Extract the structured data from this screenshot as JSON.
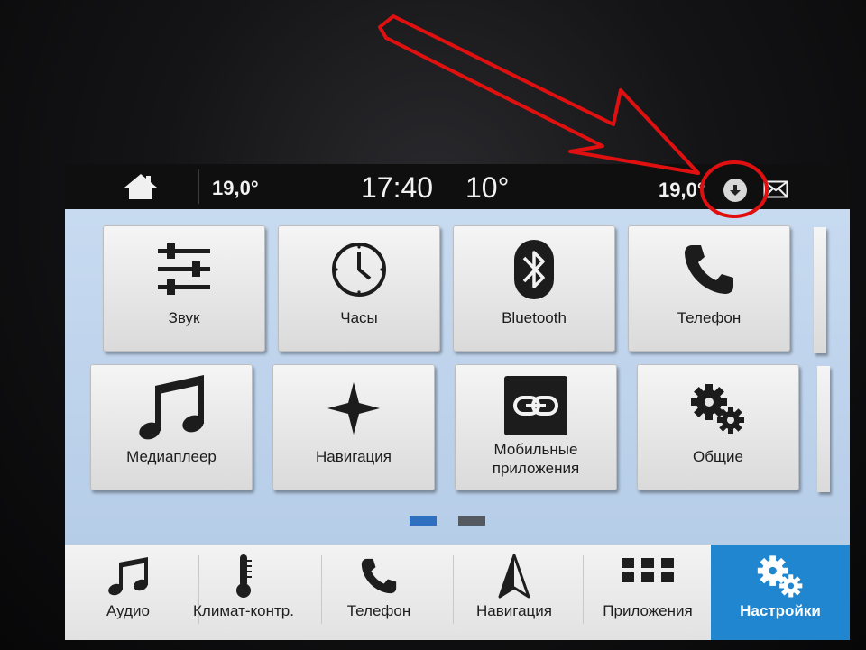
{
  "status_bar": {
    "cabin_temp_left": "19,0°",
    "time": "17:40",
    "outside_temp": "10°",
    "cabin_temp_right": "19,0°",
    "icons": [
      "home-icon",
      "download-icon",
      "mail-icon"
    ]
  },
  "tiles": [
    {
      "label": "Звук",
      "icon": "sliders-icon"
    },
    {
      "label": "Часы",
      "icon": "clock-icon"
    },
    {
      "label": "Bluetooth",
      "icon": "bluetooth-icon"
    },
    {
      "label": "Телефон",
      "icon": "phone-icon"
    },
    {
      "label": "Медиаплеер",
      "icon": "music-note-icon"
    },
    {
      "label": "Навигация",
      "icon": "star-compass-icon"
    },
    {
      "label": "Мобильные приложения",
      "icon": "link-icon"
    },
    {
      "label": "Общие",
      "icon": "gears-icon"
    }
  ],
  "pagination": {
    "pages": 2,
    "current": 1
  },
  "bottom_nav": [
    {
      "label": "Аудио",
      "icon": "music-note-icon"
    },
    {
      "label": "Климат-контр.",
      "icon": "thermometer-icon"
    },
    {
      "label": "Телефон",
      "icon": "phone-icon"
    },
    {
      "label": "Навигация",
      "icon": "navigation-arrow-icon"
    },
    {
      "label": "Приложения",
      "icon": "grid-icon"
    },
    {
      "label": "Настройки",
      "icon": "gears-icon",
      "active": true
    }
  ],
  "colors": {
    "accent": "#1f86cf",
    "content_bg": "#c7daf0",
    "annotation": "#e01010",
    "page_dot_active": "#2e6fc0",
    "page_dot_inactive": "#555a60"
  }
}
